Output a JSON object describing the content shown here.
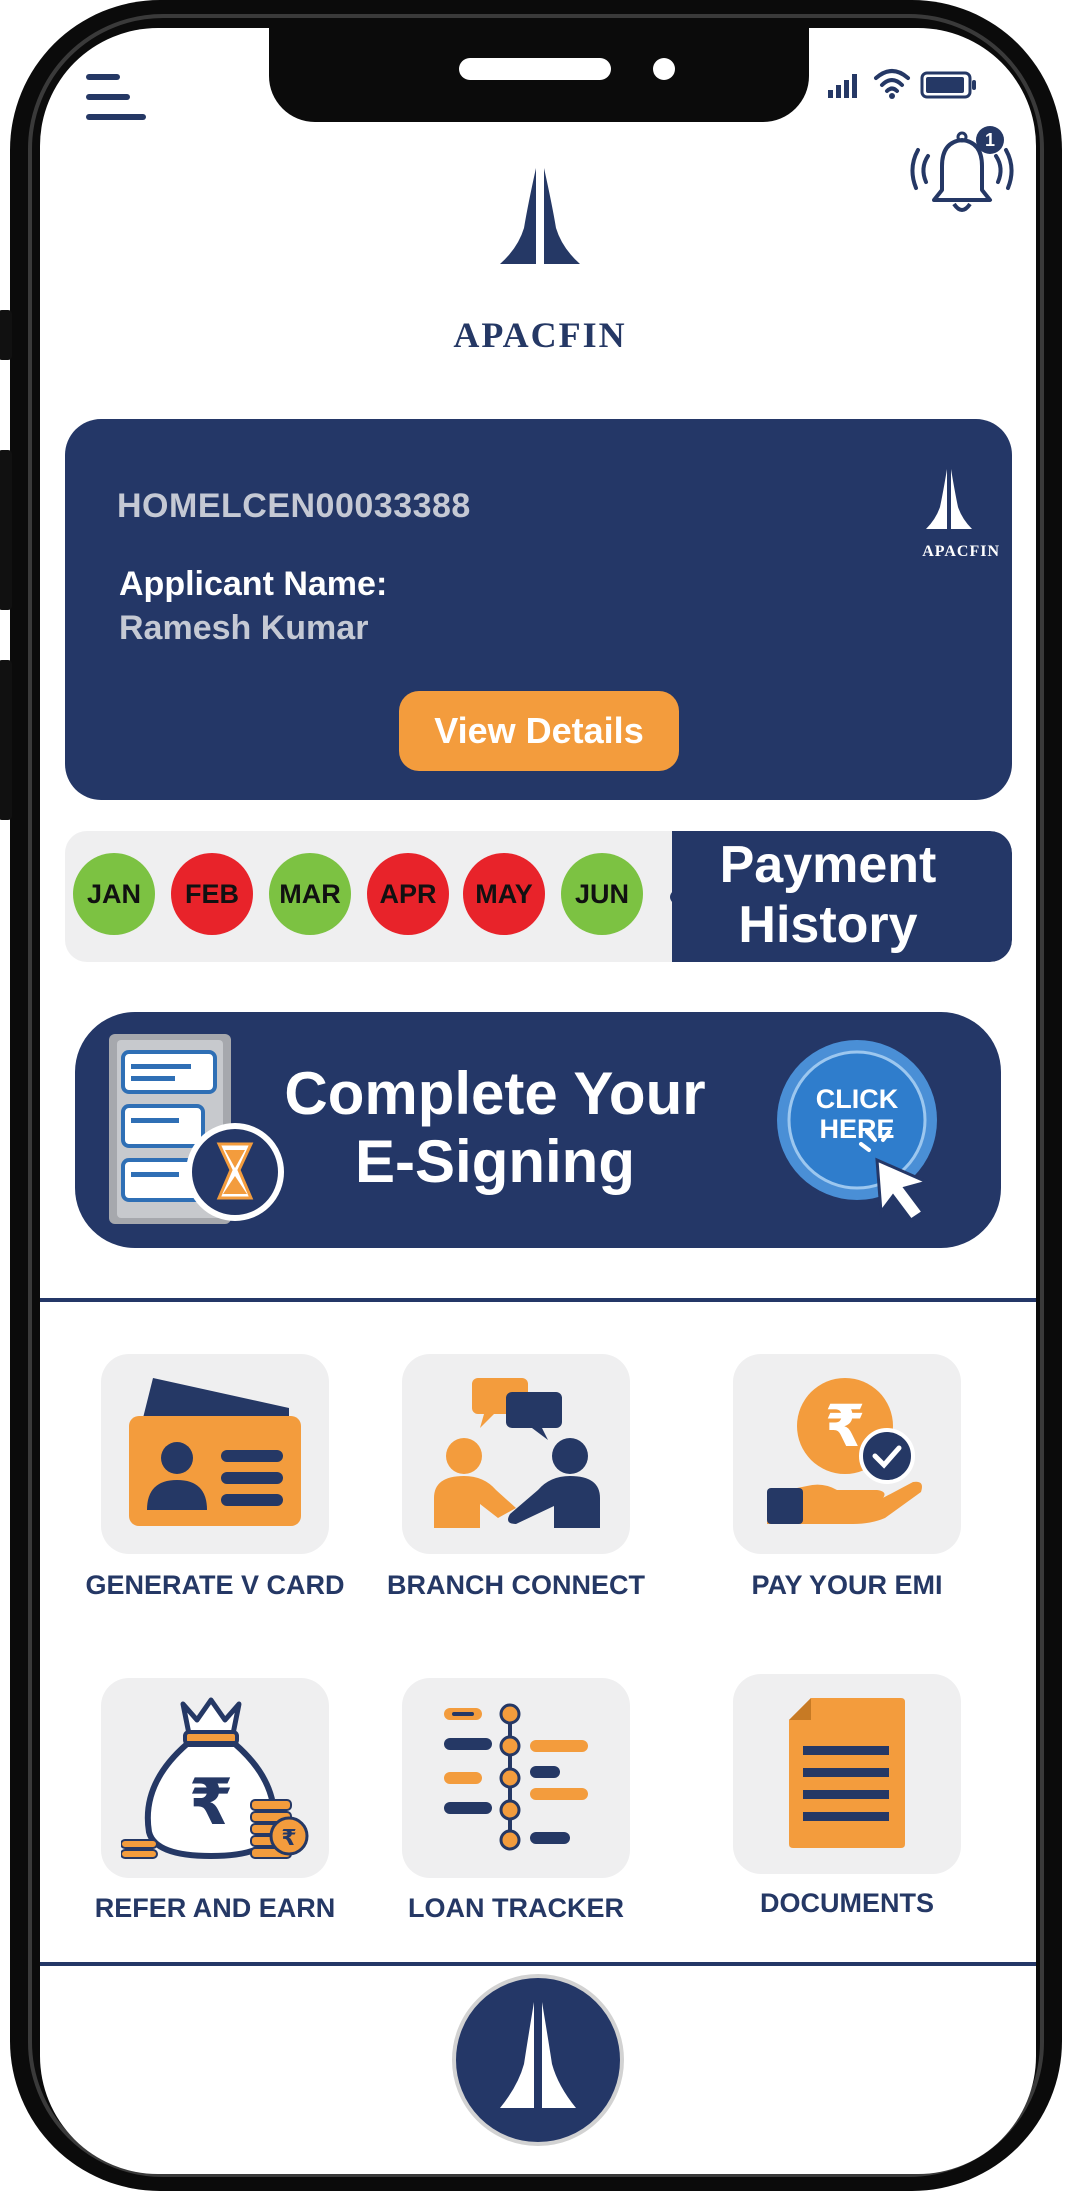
{
  "brand": {
    "name": "APACFIN"
  },
  "status_bar": {
    "signal_icon": "signal-bars-icon",
    "wifi_icon": "wifi-icon",
    "battery_icon": "battery-icon"
  },
  "header": {
    "menu_icon": "hamburger-menu-icon",
    "notification_icon": "bell-icon",
    "notification_count": "1"
  },
  "loan_card": {
    "loan_id": "HOMELCEN00033388",
    "applicant_label": "Applicant Name:",
    "applicant_name": "Ramesh Kumar",
    "view_button": "View Details"
  },
  "payment_history": {
    "title_line1": "Payment",
    "title_line2": "History",
    "months": [
      {
        "label": "JAN",
        "status": "paid"
      },
      {
        "label": "FEB",
        "status": "missed"
      },
      {
        "label": "MAR",
        "status": "paid"
      },
      {
        "label": "APR",
        "status": "missed"
      },
      {
        "label": "MAY",
        "status": "missed"
      },
      {
        "label": "JUN",
        "status": "paid"
      }
    ],
    "colors": {
      "paid": "#7cc242",
      "missed": "#e8232a"
    }
  },
  "esign_banner": {
    "line1": "Complete Your",
    "line2": "E-Signing",
    "cta_line1": "CLICK",
    "cta_line2": "HERE"
  },
  "services": [
    {
      "label": "GENERATE V CARD",
      "icon": "id-card-icon"
    },
    {
      "label": "BRANCH CONNECT",
      "icon": "handshake-chat-icon"
    },
    {
      "label": "PAY YOUR EMI",
      "icon": "rupee-hand-icon"
    },
    {
      "label": "REFER AND EARN",
      "icon": "money-bag-icon"
    },
    {
      "label": "LOAN TRACKER",
      "icon": "tracker-timeline-icon"
    },
    {
      "label": "DOCUMENTS",
      "icon": "document-icon"
    }
  ],
  "bottom_nav": {
    "home_icon": "namaste-logo-icon"
  },
  "colors": {
    "navy": "#243767",
    "orange": "#f39c3d",
    "tile_bg": "#efeff0"
  }
}
